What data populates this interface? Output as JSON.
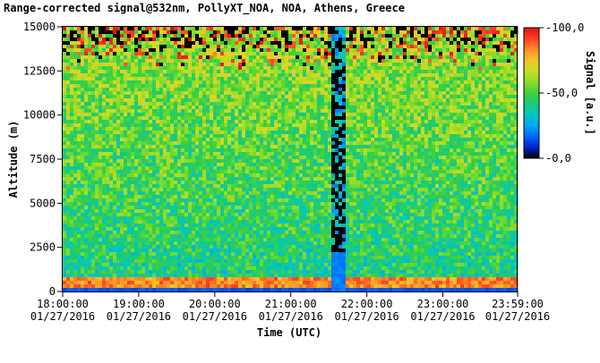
{
  "chart_data": {
    "type": "heatmap",
    "title": "Range-corrected signal@532nm, PollyXT_NOA, NOA, Athens, Greece",
    "xlabel": "Time (UTC)",
    "ylabel": "Altitude (m)",
    "colorbar_label": "Signal [a.u.]",
    "x_range": [
      "2016-01-27 18:00:00",
      "2016-01-27 23:59:00"
    ],
    "ylim": [
      0,
      15000
    ],
    "color_range": [
      0,
      100
    ],
    "x_ticks": [
      {
        "time": "18:00:00",
        "date": "01/27/2016"
      },
      {
        "time": "19:00:00",
        "date": "01/27/2016"
      },
      {
        "time": "20:00:00",
        "date": "01/27/2016"
      },
      {
        "time": "21:00:00",
        "date": "01/27/2016"
      },
      {
        "time": "22:00:00",
        "date": "01/27/2016"
      },
      {
        "time": "23:00:00",
        "date": "01/27/2016"
      },
      {
        "time": "23:59:00",
        "date": "01/27/2016"
      }
    ],
    "y_ticks": [
      "0",
      "2500",
      "5000",
      "7500",
      "10000",
      "12500",
      "15000"
    ],
    "y_tick_values": [
      0,
      2500,
      5000,
      7500,
      10000,
      12500,
      15000
    ],
    "colorbar_ticks": [
      "0,0",
      "50,0",
      "100,0"
    ],
    "colorbar_tick_values": [
      0,
      50,
      100
    ],
    "colormap": [
      "#000000",
      "#0022d0",
      "#0066ff",
      "#00a8f0",
      "#00c8c0",
      "#1ec87a",
      "#3cd23c",
      "#8cdc28",
      "#c8dc28",
      "#f0c828",
      "#ff8c28",
      "#ff4020",
      "#e01414"
    ],
    "features": {
      "boundary_layer_top_m": 900,
      "data_gap": {
        "start": "21:33",
        "end": "21:44",
        "note_value_low_m": 0,
        "note_value_high_m": 15000
      },
      "gap_residual_max_m": 2200
    }
  }
}
